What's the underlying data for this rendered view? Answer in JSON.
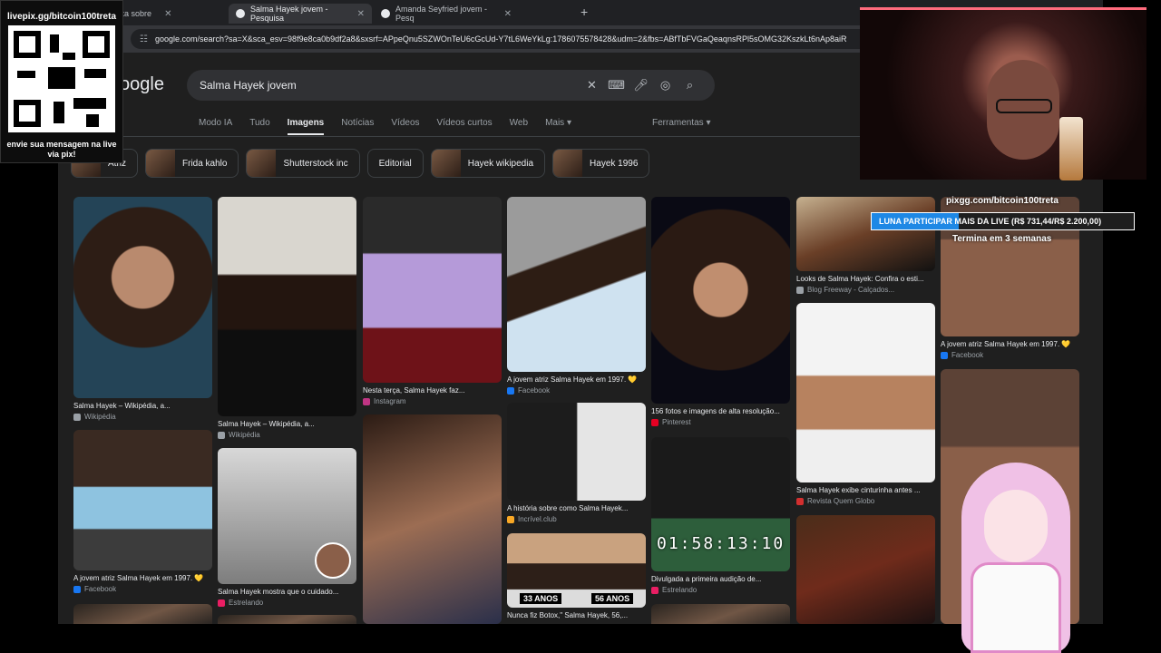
{
  "tabs": [
    {
      "label": "ayle se manifesta sobre"
    },
    {
      "label": "Salma Hayek jovem - Pesquisa"
    },
    {
      "label": "Amanda Seyfried jovem - Pesq"
    }
  ],
  "address": "google.com/search?sa=X&sca_esv=98f9e8ca0b9df2a8&sxsrf=APpeQnu5SZWOnTeU6cGcUd-Y7tL6WeYkLg:1786075578428&udm=2&fbs=ABfTbFVGaQeaqnsRPl5sOMG32KszkLt6nAp8aiR",
  "logo_text": "oogle",
  "search_query": "Salma Hayek jovem",
  "nav": [
    "Modo IA",
    "Tudo",
    "Imagens",
    "Notícias",
    "Vídeos",
    "Vídeos curtos",
    "Web",
    "Mais ▾"
  ],
  "tools": "Ferramentas ▾",
  "chips": [
    "Atriz",
    "Frida kahlo",
    "Shutterstock inc",
    "Editorial",
    "Hayek wikipedia",
    "Hayek 1996"
  ],
  "results": [
    {
      "cap": "Salma Hayek – Wikipédia, a...",
      "src": "Wikipédia"
    },
    {
      "cap": "A jovem atriz Salma Hayek em 1997. 💛",
      "src": "Facebook"
    },
    {
      "cap": "Salma Hayek – Wikipédia, a...",
      "src": "Wikipédia"
    },
    {
      "cap": "Salma Hayek mostra que o cuidado...",
      "src": "Estrelando"
    },
    {
      "cap": "Nesta terça, Salma Hayek faz...",
      "src": "Instagram"
    },
    {
      "cap": "A jovem atriz Salma Hayek em 1997. 💛",
      "src": "Facebook"
    },
    {
      "cap": "A história sobre como Salma Hayek...",
      "src": "Incrível.club"
    },
    {
      "cap": "Nunca fiz Botox,\" Salma Hayek, 56,...",
      "src": ""
    },
    {
      "cap": "156 fotos e imagens de alta resolução...",
      "src": "Pinterest"
    },
    {
      "cap": "Divulgada a primeira audição de...",
      "src": "Estrelando"
    },
    {
      "cap": "Looks de Salma Hayek: Confira o esti...",
      "src": "Blog Freeway - Calçados..."
    },
    {
      "cap": "Salma Hayek exibe cinturinha antes ...",
      "src": "Revista Quem Globo"
    },
    {
      "cap": "A jovem atriz Salma Hayek em 1997. 💛",
      "src": "Facebook"
    }
  ],
  "timer": "01:58:13:10",
  "ages": [
    "33 ANOS",
    "56 ANOS"
  ],
  "qr": {
    "title": "livepix.gg/bitcoin100treta",
    "footer": "envie sua mensagem na live via pix!"
  },
  "stream": {
    "pix_url": "pixgg.com/bitcoin100treta",
    "goal_text": "LUNA PARTICIPAR MAIS DA LIVE (R$ 731,44/R$ 2.200,00)",
    "goal_progress": 0.3325,
    "ends": "Termina em 3 semanas"
  }
}
